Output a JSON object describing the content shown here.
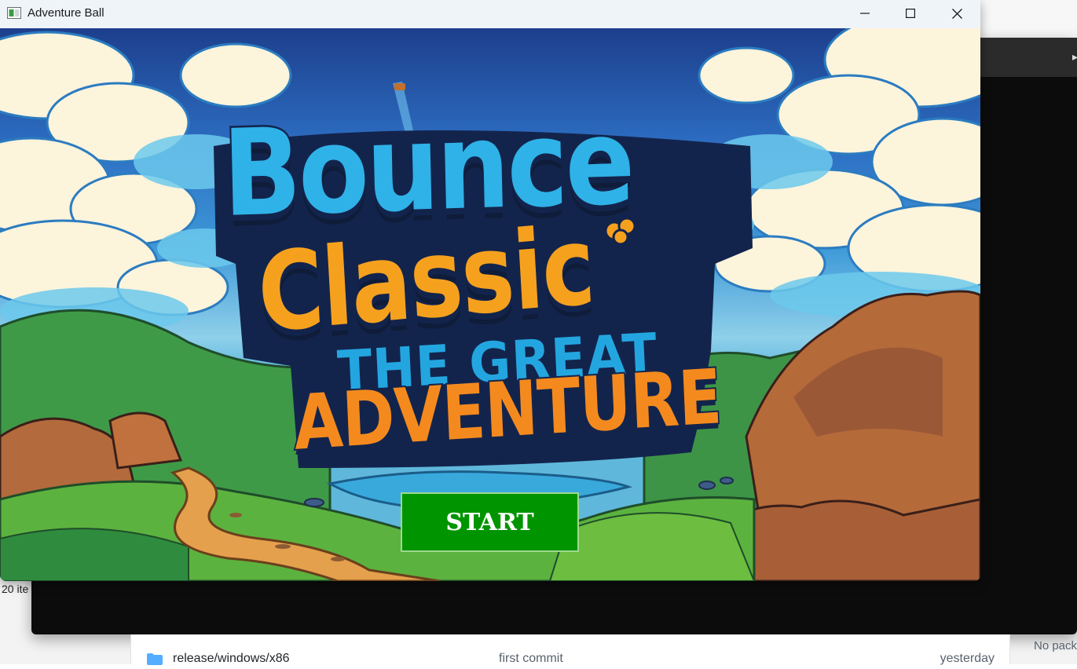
{
  "window": {
    "title": "Adventure Ball",
    "app_icon": "app-window-icon",
    "controls": [
      "minimize-icon",
      "maximize-icon",
      "close-icon"
    ]
  },
  "game": {
    "logo": {
      "line1": "Bounce",
      "line2": "Classic",
      "line3": "THE GREAT",
      "line4": "ADVENTURE"
    },
    "start_button": {
      "label": "START",
      "color": "#009500"
    }
  },
  "background": {
    "explorer_status": "20 ite",
    "file_row": {
      "icon": "folder-icon",
      "name": "release/windows/x86",
      "message": "first commit",
      "date": "yesterday"
    },
    "side_note": "No pack"
  }
}
